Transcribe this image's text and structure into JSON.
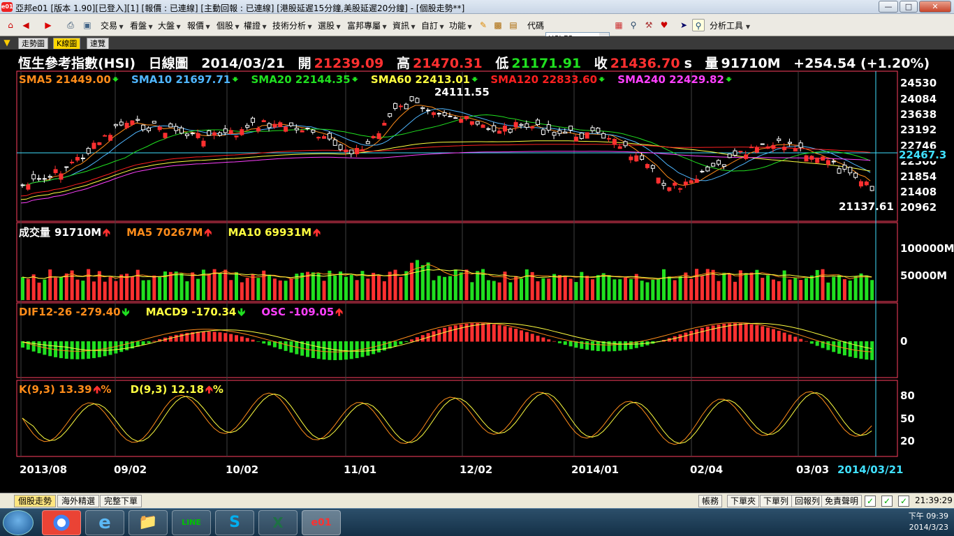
{
  "window": {
    "title": "亞邦e01 [版本 1.90][已登入][1] [報價 : 已連線] [主動回報 : 已連線] [港股延遲15分鐘,美股延遲20分鐘] - [個股走勢**]",
    "logo_text": "e01"
  },
  "menu": {
    "items": [
      "交易",
      "看盤",
      "大盤",
      "報價",
      "個股",
      "權證",
      "技術分析",
      "選股",
      "富邦專屬",
      "資訊",
      "自訂",
      "功能"
    ],
    "code_label": "代碼",
    "code_value": "HSI.FS",
    "analysis_tools": "分析工具"
  },
  "tabs": [
    "走勢圖",
    "K線圖",
    "速覽"
  ],
  "header": {
    "name": "恆生參考指數(HSI)",
    "period": "日線圖",
    "date": "2014/03/21",
    "open_label": "開",
    "open": "21239.09",
    "high_label": "高",
    "high": "21470.31",
    "low_label": "低",
    "low": "21171.91",
    "close_label": "收",
    "close": "21436.70",
    "close_suffix": "s",
    "volume_label": "量",
    "volume": "91710M",
    "change": "+254.54 (+1.20%)"
  },
  "price_panel": {
    "legends": [
      {
        "text": "SMA5 21449.00",
        "color": "#ff8c1a",
        "dir": "down"
      },
      {
        "text": "SMA10 21697.71",
        "color": "#4fb6ff",
        "dir": "down"
      },
      {
        "text": "SMA20 22144.35",
        "color": "#20e020",
        "dir": "down"
      },
      {
        "text": "SMA60 22413.01",
        "color": "#ffff40",
        "dir": "down"
      },
      {
        "text": "SMA120 22833.60",
        "color": "#ff2020",
        "dir": "down"
      },
      {
        "text": "SMA240 22429.82",
        "color": "#ff40ff",
        "dir": "down"
      }
    ],
    "high_mark": "24111.55",
    "low_mark": "21137.61",
    "current_marker": "22467.3",
    "y_ticks": [
      "24530",
      "24084",
      "23638",
      "23192",
      "22746",
      "22300",
      "21854",
      "21408",
      "20962"
    ]
  },
  "volume_panel": {
    "label": "成交量",
    "value": "91710M",
    "ma5": "MA5 70267M",
    "ma10": "MA10 69931M",
    "y_ticks": [
      "100000M",
      "50000M"
    ]
  },
  "macd_panel": {
    "dif": "DIF12-26 -279.40",
    "macd": "MACD9 -170.34",
    "osc": "OSC -109.05",
    "y_ticks": [
      "0"
    ]
  },
  "kd_panel": {
    "k": "K(9,3) 13.39",
    "d": "D(9,3) 12.18",
    "pct": "%",
    "y_ticks": [
      "80",
      "50",
      "20"
    ]
  },
  "x_axis": {
    "dates": [
      "2013/08",
      "09/02",
      "10/02",
      "11/01",
      "12/02",
      "2014/01",
      "02/04",
      "03/03"
    ],
    "current": "2014/03/21"
  },
  "bottom": {
    "tabs": [
      "個股走勢",
      "海外精選",
      "完整下單"
    ],
    "buttons": [
      "帳務",
      "下單夾",
      "下單列",
      "回報列",
      "免責聲明"
    ],
    "clock": "21:39:29"
  },
  "taskbar": {
    "apps": [
      "windows-start",
      "chrome",
      "ie",
      "explorer",
      "line",
      "skype",
      "excel",
      "e01"
    ],
    "time": "下午 09:39",
    "date": "2014/3/23"
  },
  "colors": {
    "up": "#ff3030",
    "down": "#20e020",
    "panel_border": "#ff4060",
    "grid": "#404040"
  }
}
